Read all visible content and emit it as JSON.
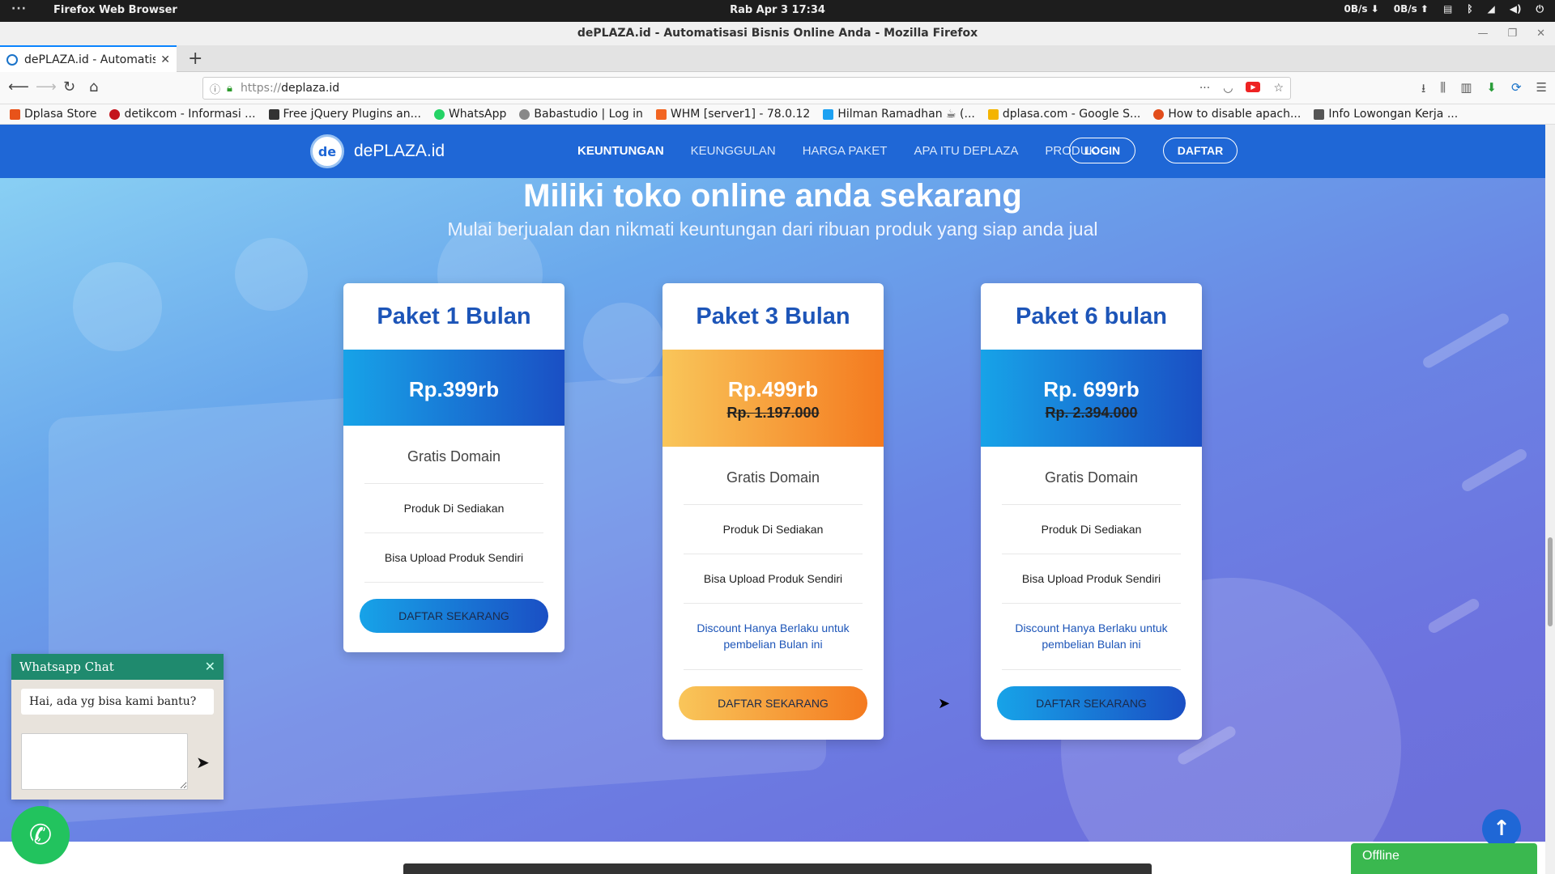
{
  "system": {
    "menu_dots": "···",
    "app_name": "Firefox Web Browser",
    "clock": "Rab Apr 3  17:34",
    "net_down": "0B/s ⬇",
    "net_up": "0B/s ⬆"
  },
  "window": {
    "title": "dePLAZA.id - Automatisasi Bisnis Online Anda - Mozilla Firefox"
  },
  "tabs": [
    {
      "label": "dePLAZA.id - Automatis"
    }
  ],
  "urlbar": {
    "protocol": "https://",
    "host": "deplaza.id"
  },
  "bookmarks": [
    {
      "label": "Dplasa Store",
      "color": "#e8531a"
    },
    {
      "label": "detikcom - Informasi ...",
      "color": "#c4141c"
    },
    {
      "label": "Free jQuery Plugins an...",
      "color": "#333333"
    },
    {
      "label": "WhatsApp",
      "color": "#25d366"
    },
    {
      "label": "Babastudio | Log in",
      "color": "#888888"
    },
    {
      "label": "WHM [server1] - 78.0.12",
      "color": "#f26522"
    },
    {
      "label": "Hilman Ramadhan ☕ (...",
      "color": "#1da1f2"
    },
    {
      "label": "dplasa.com - Google S...",
      "color": "#f4b400"
    },
    {
      "label": "How to disable apach...",
      "color": "#e24d1b"
    },
    {
      "label": "Info Lowongan Kerja ...",
      "color": "#555555"
    }
  ],
  "site": {
    "brand": "dePLAZA.id",
    "logo_text": "de",
    "nav": [
      "KEUNTUNGAN",
      "KEUNGGULAN",
      "HARGA PAKET",
      "APA ITU DEPLAZA",
      "PRODUK"
    ],
    "login": "LOGIN",
    "register": "DAFTAR",
    "hero_title": "Miliki toko online anda sekarang",
    "hero_subtitle": "Mulai berjualan dan nikmati keuntungan dari ribuan produk yang siap anda jual"
  },
  "plans": [
    {
      "name": "Paket 1 Bulan",
      "price": "Rp.399rb",
      "old_price": "",
      "features": [
        "Gratis Domain",
        "Produk Di Sediakan",
        "Bisa Upload Produk Sendiri"
      ],
      "note": "",
      "cta": "DAFTAR SEKARANG",
      "theme": "blue"
    },
    {
      "name": "Paket 3 Bulan",
      "price": "Rp.499rb",
      "old_price": "Rp. 1.197.000",
      "features": [
        "Gratis Domain",
        "Produk Di Sediakan",
        "Bisa Upload Produk Sendiri"
      ],
      "note": "Discount Hanya Berlaku untuk pembelian Bulan ini",
      "cta": "DAFTAR SEKARANG",
      "theme": "orange"
    },
    {
      "name": "Paket 6 bulan",
      "price": "Rp. 699rb",
      "old_price": "Rp. 2.394.000",
      "features": [
        "Gratis Domain",
        "Produk Di Sediakan",
        "Bisa Upload Produk Sendiri"
      ],
      "note": "Discount Hanya Berlaku untuk pembelian Bulan ini",
      "cta": "DAFTAR SEKARANG",
      "theme": "blue"
    }
  ],
  "whatsapp": {
    "title": "Whatsapp Chat",
    "greeting": "Hai, ada yg bisa kami bantu?"
  },
  "chat_status": "Offline"
}
